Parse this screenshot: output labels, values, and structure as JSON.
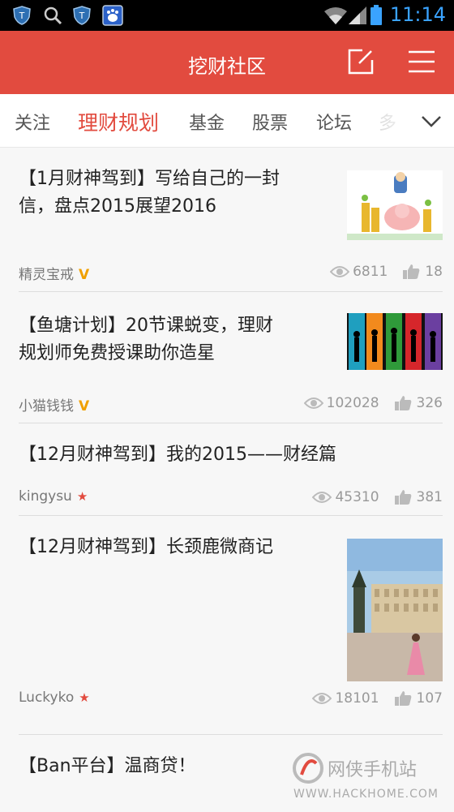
{
  "status": {
    "time": "11:14"
  },
  "appbar": {
    "title": "挖财社区"
  },
  "tabs": [
    {
      "label": "关注"
    },
    {
      "label": "理财规划"
    },
    {
      "label": "基金"
    },
    {
      "label": "股票"
    },
    {
      "label": "论坛"
    },
    {
      "label": "多"
    }
  ],
  "posts": [
    {
      "title_line1": "【1月财神驾到】写给自己的一封",
      "title_line2": "信，盘点2015展望2016",
      "author": "精灵宝戒",
      "badge": "V",
      "views": "6811",
      "likes": "18"
    },
    {
      "title_line1": "【鱼塘计划】20节课蜕变，理财",
      "title_line2": "规划师免费授课助你造星",
      "author": "小猫钱钱",
      "badge": "V",
      "views": "102028",
      "likes": "326"
    },
    {
      "title_line1": "【12月财神驾到】我的2015——财经篇",
      "title_line2": "",
      "author": "kingysu",
      "badge": "★",
      "views": "45310",
      "likes": "381"
    },
    {
      "title_line1": "【12月财神驾到】长颈鹿微商记",
      "title_line2": "",
      "author": "Luckyko",
      "badge": "★",
      "views": "18101",
      "likes": "107"
    },
    {
      "title_line1": "【Ban平台】温商贷！",
      "title_line2": ""
    }
  ],
  "watermark": {
    "name": "网侠手机站",
    "url": "WWW.HACKHOME.COM"
  },
  "colors": {
    "accent": "#e24b3f",
    "time": "#3aa3ff",
    "vbadge": "#f0a000"
  }
}
